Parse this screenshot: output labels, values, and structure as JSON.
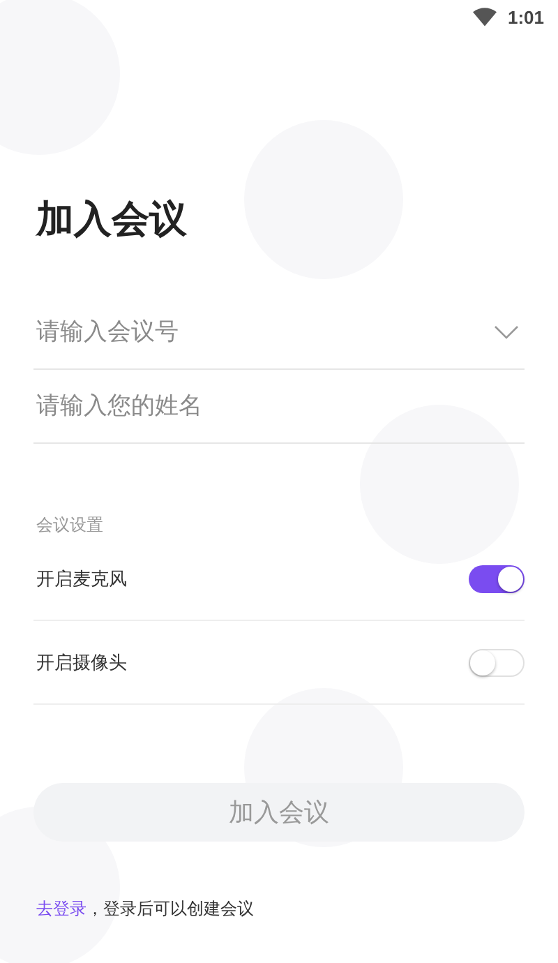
{
  "status_bar": {
    "time": "1:01"
  },
  "title": "加入会议",
  "fields": [
    {
      "placeholder": "请输入会议号",
      "dropdown": true
    },
    {
      "placeholder": "请输入您的姓名",
      "dropdown": false
    }
  ],
  "settings": {
    "heading": "会议设置",
    "items": [
      {
        "label": "开启麦克风",
        "on": true
      },
      {
        "label": "开启摄像头",
        "on": false
      }
    ]
  },
  "join_button": {
    "label": "加入会议",
    "disabled": true
  },
  "footer": {
    "link": "去登录",
    "text": "，登录后可以创建会议"
  }
}
